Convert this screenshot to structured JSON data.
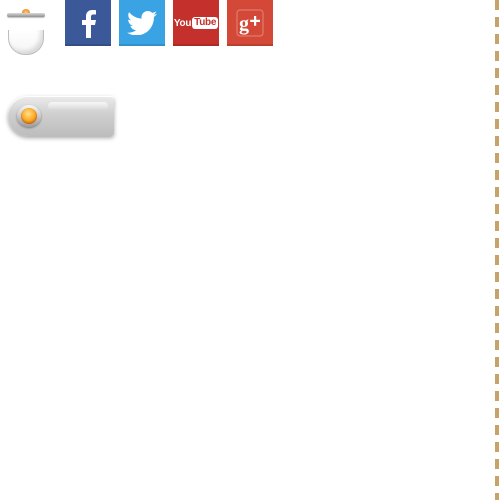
{
  "colors": {
    "facebook": "#3b5998",
    "twitter": "#3aa3e3",
    "youtube": "#c4302b",
    "google_plus": "#d34836",
    "dashed_border": "#c4a46a",
    "toggle_knob": "#ff9a1f"
  },
  "social": {
    "facebook": {
      "icon": "facebook-icon"
    },
    "twitter": {
      "icon": "twitter-icon"
    },
    "youtube": {
      "icon": "youtube-icon",
      "label_you": "You",
      "label_tube": "Tube"
    },
    "google_plus": {
      "icon": "google-plus-icon",
      "label": "g+"
    }
  },
  "toggle": {
    "icon": "toggle-switch",
    "state": "off"
  }
}
